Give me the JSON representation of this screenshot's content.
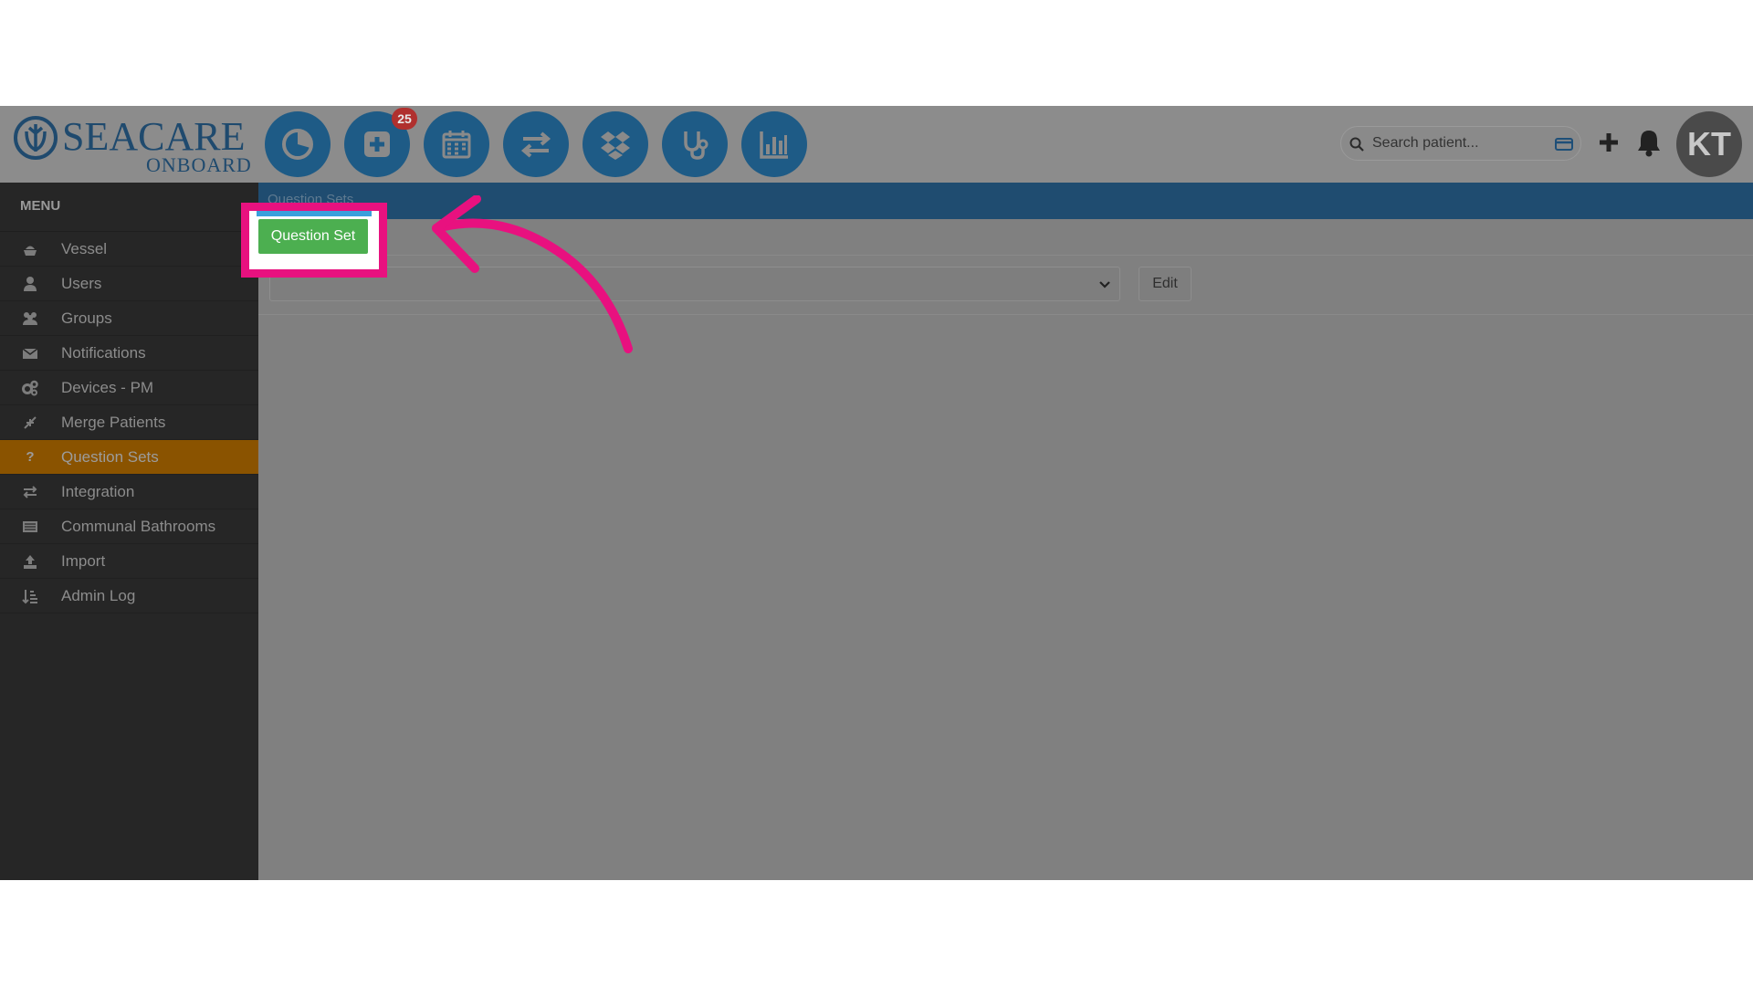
{
  "header": {
    "logo_main": "SEACARE",
    "logo_sub": "ONBOARD",
    "nav_icons": [
      {
        "name": "dashboard-pie-icon"
      },
      {
        "name": "medical-plus-icon",
        "badge": "25"
      },
      {
        "name": "calendar-icon"
      },
      {
        "name": "transfer-arrows-icon"
      },
      {
        "name": "dropbox-icon"
      },
      {
        "name": "stethoscope-icon"
      },
      {
        "name": "bar-chart-icon"
      }
    ],
    "search_placeholder": "Search patient...",
    "avatar_initials": "KT"
  },
  "sidebar": {
    "title": "MENU",
    "items": [
      {
        "label": "Vessel",
        "icon": "vessel-icon"
      },
      {
        "label": "Users",
        "icon": "user-icon"
      },
      {
        "label": "Groups",
        "icon": "group-icon"
      },
      {
        "label": "Notifications",
        "icon": "envelope-icon"
      },
      {
        "label": "Devices - PM",
        "icon": "gears-icon"
      },
      {
        "label": "Merge Patients",
        "icon": "merge-icon"
      },
      {
        "label": "Question Sets",
        "icon": "question-icon",
        "active": true
      },
      {
        "label": "Integration",
        "icon": "exchange-icon"
      },
      {
        "label": "Communal Bathrooms",
        "icon": "list-icon"
      },
      {
        "label": "Import",
        "icon": "upload-icon"
      },
      {
        "label": "Admin Log",
        "icon": "sort-icon"
      }
    ]
  },
  "content": {
    "breadcrumb": "Question Sets",
    "question_set_button": "Question Set",
    "edit_button": "Edit",
    "select_value": ""
  },
  "colors": {
    "nav_blue": "#1e5b86",
    "header_gray": "#8c8c8c",
    "active_orange": "#8a5300",
    "highlight_pink": "#e8117f",
    "button_green": "#4caf50"
  }
}
